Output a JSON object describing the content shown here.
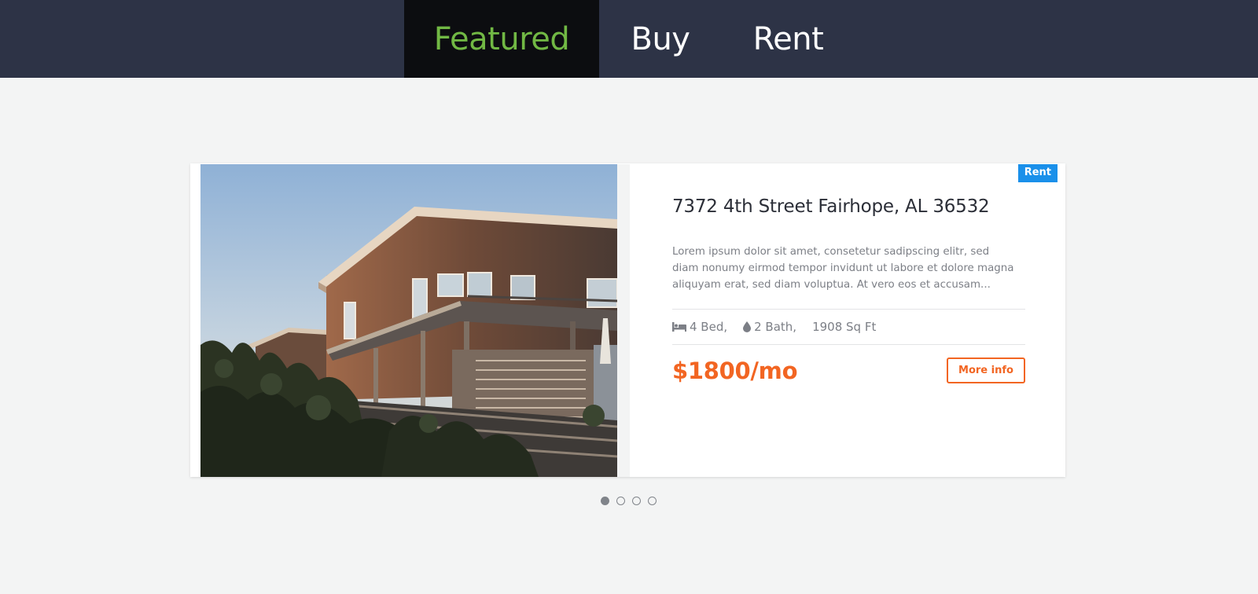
{
  "nav": {
    "tabs": [
      {
        "label": "Featured",
        "active": true
      },
      {
        "label": "Buy",
        "active": false
      },
      {
        "label": "Rent",
        "active": false
      }
    ]
  },
  "listing": {
    "badge": "Rent",
    "address": "7372 4th Street Fairhope, AL 36532",
    "description": "Lorem ipsum dolor sit amet, consetetur sadipscing elitr, sed diam nonumy eirmod tempor invidunt ut labore et dolore magna aliquyam erat, sed diam voluptua. At vero eos et accusam...",
    "beds": "4 Bed,",
    "baths": "2 Bath,",
    "area": "1908 Sq Ft",
    "price": "$1800/mo",
    "more_label": "More info",
    "bed_icon": "bed-icon",
    "bath_icon": "water-drop-icon"
  },
  "carousel": {
    "slide_count": 4,
    "active_index": 0
  },
  "colors": {
    "nav_bg": "#2d3346",
    "active_tab_bg": "#0c0d10",
    "active_tab_text": "#71b844",
    "accent": "#f26522",
    "badge_bg": "#1a90ea",
    "page_bg": "#f3f4f4"
  }
}
